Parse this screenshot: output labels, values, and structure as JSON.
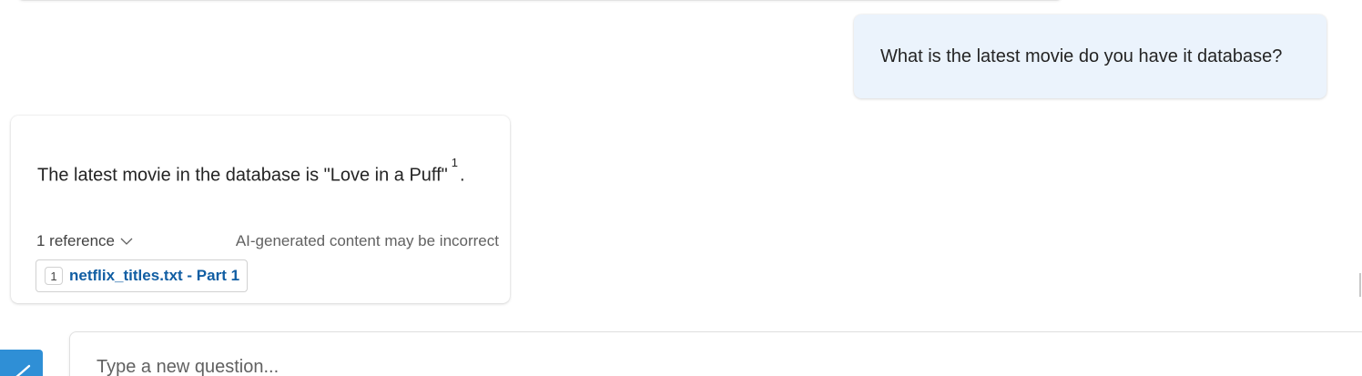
{
  "chat": {
    "user_message": "What is the latest movie do you have it database?",
    "bot_message": {
      "text": "The latest movie in the database is \"Love in a Puff\"",
      "citation_marker": "1",
      "trailing": ".",
      "references_toggle": "1 reference",
      "disclaimer": "AI-generated content may be incorrect",
      "references": [
        {
          "number": "1",
          "name": "netflix_titles.txt - Part 1"
        }
      ]
    }
  },
  "composer": {
    "placeholder": "Type a new question..."
  },
  "icons": {
    "references_toggle": "chevron-down-icon",
    "assistant_button": "checkmark-icon"
  },
  "colors": {
    "user_bubble": "#ebf3fc",
    "link": "#115ea3",
    "assistant_button": "#2f8fd6"
  }
}
